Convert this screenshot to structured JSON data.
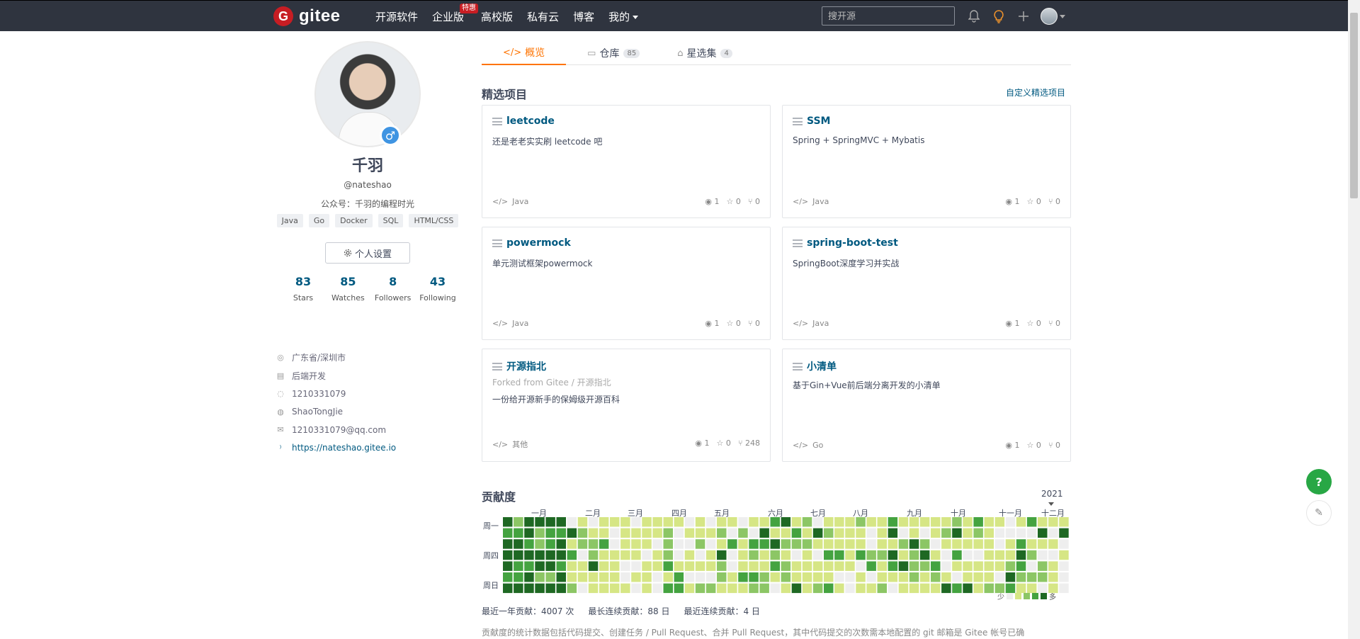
{
  "topbar": {
    "logo_text": "gitee",
    "logo_mark": "G",
    "nav": [
      {
        "label": "开源软件"
      },
      {
        "label": "企业版",
        "badge": "特惠"
      },
      {
        "label": "高校版"
      },
      {
        "label": "私有云"
      },
      {
        "label": "博客"
      },
      {
        "label": "我的"
      }
    ],
    "search_placeholder": "搜开源"
  },
  "profile": {
    "name": "千羽",
    "handle": "@nateshao",
    "bio": "公众号：千羽的编程时光",
    "tags": [
      "Java",
      "Go",
      "Docker",
      "SQL",
      "HTML/CSS"
    ],
    "settings_label": "个人设置",
    "stats": [
      {
        "num": "83",
        "label": "Stars"
      },
      {
        "num": "85",
        "label": "Watches"
      },
      {
        "num": "8",
        "label": "Followers"
      },
      {
        "num": "43",
        "label": "Following"
      }
    ],
    "info": {
      "location": "广东省/深圳市",
      "job": "后端开发",
      "qq": "1210331079",
      "wechat": "ShaoTongJie",
      "email": "1210331079@qq.com",
      "website": "https://nateshao.gitee.io"
    }
  },
  "tabs": [
    {
      "label": "概览",
      "count": "",
      "icon": "overview-icon"
    },
    {
      "label": "仓库",
      "count": "85",
      "icon": "repo-icon"
    },
    {
      "label": "星选集",
      "count": "4",
      "icon": "star-collection-icon"
    }
  ],
  "featured": {
    "title": "精选项目",
    "customize": "自定义精选项目",
    "cards": [
      {
        "title": "leetcode",
        "desc": "还是老老实实刷 leetcode 吧",
        "lang": "Java",
        "watch": "1",
        "star": "0",
        "fork": "0"
      },
      {
        "title": "SSM",
        "desc": "Spring + SpringMVC + Mybatis",
        "lang": "Java",
        "watch": "1",
        "star": "0",
        "fork": "0"
      },
      {
        "title": "powermock",
        "desc": "单元测试框架powermock",
        "lang": "Java",
        "watch": "1",
        "star": "0",
        "fork": "0"
      },
      {
        "title": "spring-boot-test",
        "desc": "SpringBoot深度学习并实战",
        "lang": "Java",
        "watch": "1",
        "star": "0",
        "fork": "0"
      },
      {
        "title": "开源指北",
        "fork_from": "Forked from Gitee / 开源指北",
        "desc": "一份给开源新手的保姆级开源百科",
        "lang": "其他",
        "watch": "1",
        "star": "0",
        "fork": "248"
      },
      {
        "title": "小清单",
        "desc": "基于Gin+Vue前后端分离开发的小清单",
        "lang": "Go",
        "watch": "1",
        "star": "0",
        "fork": "0"
      }
    ]
  },
  "contrib": {
    "title": "贡献度",
    "year": "2021",
    "months": [
      "一月",
      "二月",
      "三月",
      "四月",
      "五月",
      "六月",
      "七月",
      "八月",
      "九月",
      "十月",
      "十一月",
      "十二月"
    ],
    "days": [
      "周一",
      "周四",
      "周日"
    ],
    "legend_less": "少",
    "legend_more": "多",
    "colors": [
      "#eeeeee",
      "#d6e685",
      "#8cc665",
      "#44a340",
      "#1e6823"
    ],
    "summary_total": "最近一年贡献：4007 次",
    "summary_longest": "最长连续贡献：88 日",
    "summary_current": "最近连续贡献：4 日",
    "note": "贡献度的统计数据包括代码提交、创建任务 / Pull Request、合并 Pull Request，其中代码提交的次数需本地配置的 git 邮箱是 Gitee 帐号已确"
  },
  "fab": {
    "help": "?"
  }
}
